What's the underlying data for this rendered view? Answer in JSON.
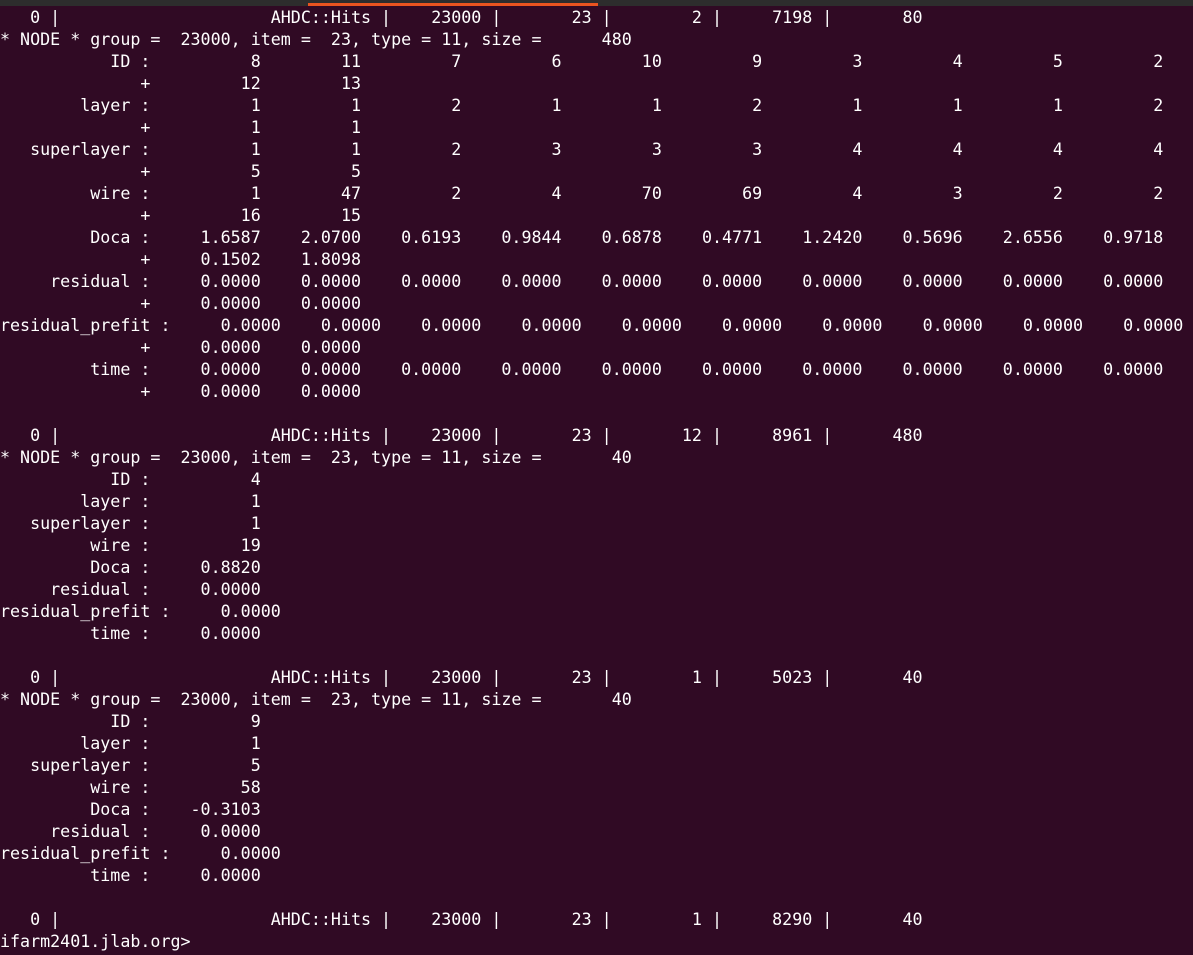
{
  "window": {
    "accent_color": "#e95420",
    "background_color": "#300a24",
    "text_color": "#ffffff"
  },
  "terminal": {
    "output": "   0 |                     AHDC::Hits |    23000 |       23 |        2 |     7198 |       80\n* NODE * group =  23000, item =  23, type = 11, size =      480\n           ID :          8        11         7         6        10         9         3         4         5         2\n              +         12        13\n        layer :          1         1         2         1         1         2         1         1         1         2\n              +          1         1\n   superlayer :          1         1         2         3         3         3         4         4         4         4\n              +          5         5\n         wire :          1        47         2         4        70        69         4         3         2         2\n              +         16        15\n         Doca :     1.6587    2.0700    0.6193    0.9844    0.6878    0.4771    1.2420    0.5696    2.6556    0.9718\n              +     0.1502    1.8098\n     residual :     0.0000    0.0000    0.0000    0.0000    0.0000    0.0000    0.0000    0.0000    0.0000    0.0000\n              +     0.0000    0.0000\nresidual_prefit :     0.0000    0.0000    0.0000    0.0000    0.0000    0.0000    0.0000    0.0000    0.0000    0.0000\n              +     0.0000    0.0000\n         time :     0.0000    0.0000    0.0000    0.0000    0.0000    0.0000    0.0000    0.0000    0.0000    0.0000\n              +     0.0000    0.0000\n\n   0 |                     AHDC::Hits |    23000 |       23 |       12 |     8961 |      480\n* NODE * group =  23000, item =  23, type = 11, size =       40\n           ID :          4\n        layer :          1\n   superlayer :          1\n         wire :         19\n         Doca :     0.8820\n     residual :     0.0000\nresidual_prefit :     0.0000\n         time :     0.0000\n\n   0 |                     AHDC::Hits |    23000 |       23 |        1 |     5023 |       40\n* NODE * group =  23000, item =  23, type = 11, size =       40\n           ID :          9\n        layer :          1\n   superlayer :          5\n         wire :         58\n         Doca :    -0.3103\n     residual :     0.0000\nresidual_prefit :     0.0000\n         time :     0.0000\n\n   0 |                     AHDC::Hits |    23000 |       23 |        1 |     8290 |       40",
    "prompt": "ifarm2401.jlab.org>"
  }
}
